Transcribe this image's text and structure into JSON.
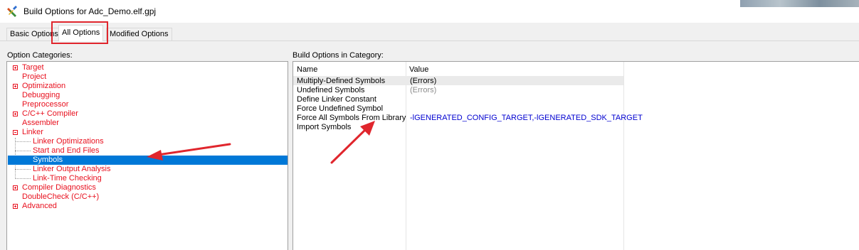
{
  "window": {
    "title": "Build Options for Adc_Demo.elf.gpj",
    "icon": "wrench-screwdriver-icon"
  },
  "tabs": [
    {
      "label": "Basic Options",
      "active": false
    },
    {
      "label": "All Options",
      "active": true
    },
    {
      "label": "Modified Options",
      "active": false
    }
  ],
  "categories": {
    "label": "Option Categories:",
    "items": [
      {
        "label": "Target",
        "expandable": true
      },
      {
        "label": "Project",
        "expandable": false
      },
      {
        "label": "Optimization",
        "expandable": true
      },
      {
        "label": "Debugging",
        "expandable": false
      },
      {
        "label": "Preprocessor",
        "expandable": false
      },
      {
        "label": "C/C++ Compiler",
        "expandable": true
      },
      {
        "label": "Assembler",
        "expandable": false
      },
      {
        "label": "Linker",
        "expandable": true,
        "expanded": true
      },
      {
        "label": "Linker Optimizations",
        "child": true
      },
      {
        "label": "Start and End Files",
        "child": true
      },
      {
        "label": "Symbols",
        "child": true,
        "selected": true
      },
      {
        "label": "Linker Output Analysis",
        "child": true
      },
      {
        "label": "Link-Time Checking",
        "child": true
      },
      {
        "label": "Compiler Diagnostics",
        "expandable": true
      },
      {
        "label": "DoubleCheck (C/C++)",
        "expandable": false
      },
      {
        "label": "Advanced",
        "expandable": true
      }
    ]
  },
  "options": {
    "label": "Build Options in Category:",
    "columns": {
      "name": "Name",
      "value": "Value"
    },
    "rows": [
      {
        "name": "Multiply-Defined Symbols",
        "value": "(Errors)",
        "style": "normal"
      },
      {
        "name": "Undefined Symbols",
        "value": "(Errors)",
        "style": "default"
      },
      {
        "name": "Define Linker Constant",
        "value": "",
        "style": "normal"
      },
      {
        "name": "Force Undefined Symbol",
        "value": "",
        "style": "normal"
      },
      {
        "name": "Force All Symbols From Library",
        "value": "-lGENERATED_CONFIG_TARGET,-lGENERATED_SDK_TARGET",
        "style": "custom"
      },
      {
        "name": "Import Symbols",
        "value": "",
        "style": "normal"
      }
    ]
  },
  "colors": {
    "annotation_red": "#e0262d",
    "category_text": "#e8101e",
    "selection": "#0078d7",
    "custom_value": "#0000d0"
  }
}
